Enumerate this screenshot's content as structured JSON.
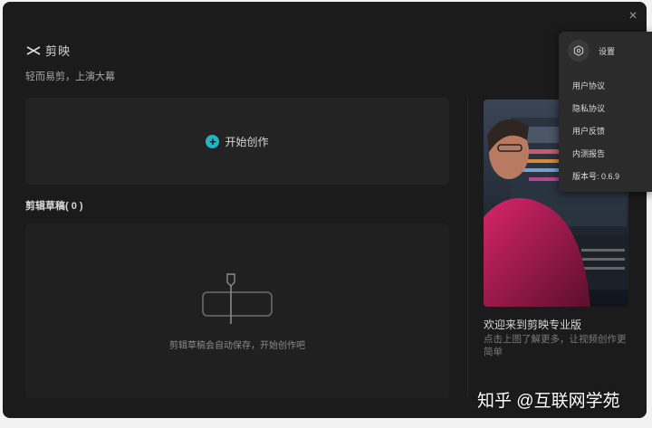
{
  "app": {
    "name": "剪映",
    "slogan": "轻而易剪，上演大幕"
  },
  "window": {
    "close_icon": "×"
  },
  "start": {
    "label": "开始创作"
  },
  "drafts": {
    "title": "剪辑草稿( 0 )",
    "empty_hint": "剪辑草稿会自动保存，开始创作吧"
  },
  "promo": {
    "title": "欢迎来到剪映专业版",
    "description": "点击上图了解更多，让视频创作更简单"
  },
  "settings_menu": {
    "label": "设置",
    "items": [
      "用户协议",
      "隐私协议",
      "用户反馈",
      "内测报告",
      "版本号: 0.6.9"
    ]
  },
  "watermark": {
    "text": "知乎 @互联网学苑"
  },
  "colors": {
    "accent": "#1fb6c1",
    "background": "#1b1b1b",
    "panel": "#232323"
  }
}
